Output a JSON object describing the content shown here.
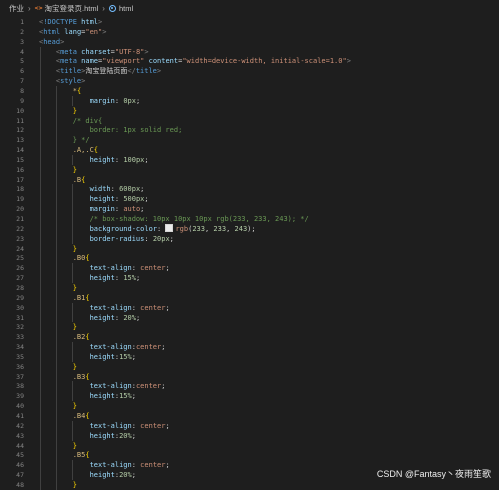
{
  "breadcrumb": {
    "folder": "作业",
    "file_icon": "html-file-icon",
    "file": "淘宝登录页.html",
    "element_icon": "symbol-element-icon",
    "element": "html"
  },
  "watermark": "CSDN @Fantasy丶夜雨笙歌",
  "code_lines": [
    {
      "n": "1",
      "t": [
        [
          "t-punct",
          "<"
        ],
        [
          "t-tag",
          "!DOCTYPE"
        ],
        [
          "t-text",
          " "
        ],
        [
          "t-attr",
          "html"
        ],
        [
          "t-punct",
          ">"
        ]
      ]
    },
    {
      "n": "2",
      "t": [
        [
          "t-punct",
          "<"
        ],
        [
          "t-tag",
          "html"
        ],
        [
          "t-text",
          " "
        ],
        [
          "t-attr",
          "lang"
        ],
        [
          "t-text",
          "="
        ],
        [
          "t-str",
          "\"en\""
        ],
        [
          "t-punct",
          ">"
        ]
      ]
    },
    {
      "n": "3",
      "t": [
        [
          "t-punct",
          "<"
        ],
        [
          "t-tag",
          "head"
        ],
        [
          "t-punct",
          ">"
        ]
      ]
    },
    {
      "n": "4",
      "t": [
        [
          "t-text",
          "    "
        ],
        [
          "t-punct",
          "<"
        ],
        [
          "t-tag",
          "meta"
        ],
        [
          "t-text",
          " "
        ],
        [
          "t-attr",
          "charset"
        ],
        [
          "t-text",
          "="
        ],
        [
          "t-str",
          "\"UTF-8\""
        ],
        [
          "t-punct",
          ">"
        ]
      ]
    },
    {
      "n": "5",
      "t": [
        [
          "t-text",
          "    "
        ],
        [
          "t-punct",
          "<"
        ],
        [
          "t-tag",
          "meta"
        ],
        [
          "t-text",
          " "
        ],
        [
          "t-attr",
          "name"
        ],
        [
          "t-text",
          "="
        ],
        [
          "t-str",
          "\"viewport\""
        ],
        [
          "t-text",
          " "
        ],
        [
          "t-attr",
          "content"
        ],
        [
          "t-text",
          "="
        ],
        [
          "t-str",
          "\"width=device-width, initial-scale=1.0\""
        ],
        [
          "t-punct",
          ">"
        ]
      ]
    },
    {
      "n": "6",
      "t": [
        [
          "t-text",
          "    "
        ],
        [
          "t-punct",
          "<"
        ],
        [
          "t-tag",
          "title"
        ],
        [
          "t-punct",
          ">"
        ],
        [
          "t-text",
          "淘宝登陆页面"
        ],
        [
          "t-punct",
          "</"
        ],
        [
          "t-tag",
          "title"
        ],
        [
          "t-punct",
          ">"
        ]
      ]
    },
    {
      "n": "7",
      "t": [
        [
          "t-text",
          "    "
        ],
        [
          "t-punct",
          "<"
        ],
        [
          "t-tag",
          "style"
        ],
        [
          "t-punct",
          ">"
        ]
      ]
    },
    {
      "n": "8",
      "t": [
        [
          "t-text",
          "        "
        ],
        [
          "t-sel",
          "*"
        ],
        [
          "t-brace",
          "{"
        ]
      ]
    },
    {
      "n": "9",
      "t": [
        [
          "t-text",
          "            "
        ],
        [
          "t-prop",
          "margin"
        ],
        [
          "t-text",
          ": "
        ],
        [
          "t-num",
          "0px"
        ],
        [
          "t-text",
          ";"
        ]
      ]
    },
    {
      "n": "10",
      "t": [
        [
          "t-text",
          "        "
        ],
        [
          "t-brace",
          "}"
        ]
      ]
    },
    {
      "n": "11",
      "t": [
        [
          "t-text",
          "        "
        ],
        [
          "t-com",
          "/* div{"
        ]
      ]
    },
    {
      "n": "12",
      "t": [
        [
          "t-text",
          "            "
        ],
        [
          "t-com",
          "border: 1px solid red;"
        ]
      ]
    },
    {
      "n": "13",
      "t": [
        [
          "t-text",
          "        "
        ],
        [
          "t-com",
          "} */"
        ]
      ]
    },
    {
      "n": "14",
      "t": [
        [
          "t-text",
          "        "
        ],
        [
          "t-sel",
          ".A,.C"
        ],
        [
          "t-brace",
          "{"
        ]
      ]
    },
    {
      "n": "15",
      "t": [
        [
          "t-text",
          "            "
        ],
        [
          "t-prop",
          "height"
        ],
        [
          "t-text",
          ": "
        ],
        [
          "t-num",
          "100px"
        ],
        [
          "t-text",
          ";"
        ]
      ]
    },
    {
      "n": "16",
      "t": [
        [
          "t-text",
          "        "
        ],
        [
          "t-brace",
          "}"
        ]
      ]
    },
    {
      "n": "17",
      "t": [
        [
          "t-text",
          "        "
        ],
        [
          "t-sel",
          ".B"
        ],
        [
          "t-brace",
          "{"
        ]
      ]
    },
    {
      "n": "18",
      "t": [
        [
          "t-text",
          "            "
        ],
        [
          "t-prop",
          "width"
        ],
        [
          "t-text",
          ": "
        ],
        [
          "t-num",
          "600px"
        ],
        [
          "t-text",
          ";"
        ]
      ]
    },
    {
      "n": "19",
      "t": [
        [
          "t-text",
          "            "
        ],
        [
          "t-prop",
          "height"
        ],
        [
          "t-text",
          ": "
        ],
        [
          "t-num",
          "500px"
        ],
        [
          "t-text",
          ";"
        ]
      ]
    },
    {
      "n": "20",
      "t": [
        [
          "t-text",
          "            "
        ],
        [
          "t-prop",
          "margin"
        ],
        [
          "t-text",
          ": "
        ],
        [
          "t-val",
          "auto"
        ],
        [
          "t-text",
          ";"
        ]
      ]
    },
    {
      "n": "21",
      "t": [
        [
          "t-text",
          "            "
        ],
        [
          "t-com",
          "/* box-shadow: 10px 10px 10px rgb(233, 233, 243); */"
        ]
      ]
    },
    {
      "n": "22",
      "t": [
        [
          "t-text",
          "            "
        ],
        [
          "t-prop",
          "background-color"
        ],
        [
          "t-text",
          ": "
        ],
        [
          "swatch",
          ""
        ],
        [
          "t-val",
          "rgb"
        ],
        [
          "t-text",
          "("
        ],
        [
          "t-num",
          "233"
        ],
        [
          "t-text",
          ", "
        ],
        [
          "t-num",
          "233"
        ],
        [
          "t-text",
          ", "
        ],
        [
          "t-num",
          "243"
        ],
        [
          "t-text",
          ");"
        ]
      ]
    },
    {
      "n": "23",
      "t": [
        [
          "t-text",
          "            "
        ],
        [
          "t-prop",
          "border-radius"
        ],
        [
          "t-text",
          ": "
        ],
        [
          "t-num",
          "20px"
        ],
        [
          "t-text",
          ";"
        ]
      ]
    },
    {
      "n": "24",
      "t": [
        [
          "t-text",
          "        "
        ],
        [
          "t-brace",
          "}"
        ]
      ]
    },
    {
      "n": "25",
      "t": [
        [
          "t-text",
          "        "
        ],
        [
          "t-sel",
          ".B0"
        ],
        [
          "t-brace",
          "{"
        ]
      ]
    },
    {
      "n": "26",
      "t": [
        [
          "t-text",
          "            "
        ],
        [
          "t-prop",
          "text-align"
        ],
        [
          "t-text",
          ": "
        ],
        [
          "t-val",
          "center"
        ],
        [
          "t-text",
          ";"
        ]
      ]
    },
    {
      "n": "27",
      "t": [
        [
          "t-text",
          "            "
        ],
        [
          "t-prop",
          "height"
        ],
        [
          "t-text",
          ": "
        ],
        [
          "t-num",
          "15%"
        ],
        [
          "t-text",
          ";"
        ]
      ]
    },
    {
      "n": "28",
      "t": [
        [
          "t-text",
          "        "
        ],
        [
          "t-brace",
          "}"
        ]
      ]
    },
    {
      "n": "29",
      "t": [
        [
          "t-text",
          "        "
        ],
        [
          "t-sel",
          ".B1"
        ],
        [
          "t-brace",
          "{"
        ]
      ]
    },
    {
      "n": "30",
      "t": [
        [
          "t-text",
          "            "
        ],
        [
          "t-prop",
          "text-align"
        ],
        [
          "t-text",
          ": "
        ],
        [
          "t-val",
          "center"
        ],
        [
          "t-text",
          ";"
        ]
      ]
    },
    {
      "n": "31",
      "t": [
        [
          "t-text",
          "            "
        ],
        [
          "t-prop",
          "height"
        ],
        [
          "t-text",
          ": "
        ],
        [
          "t-num",
          "20%"
        ],
        [
          "t-text",
          ";"
        ]
      ]
    },
    {
      "n": "32",
      "t": [
        [
          "t-text",
          "        "
        ],
        [
          "t-brace",
          "}"
        ]
      ]
    },
    {
      "n": "33",
      "t": [
        [
          "t-text",
          "        "
        ],
        [
          "t-sel",
          ".B2"
        ],
        [
          "t-brace",
          "{"
        ]
      ]
    },
    {
      "n": "34",
      "t": [
        [
          "t-text",
          "            "
        ],
        [
          "t-prop",
          "text-align"
        ],
        [
          "t-text",
          ":"
        ],
        [
          "t-val",
          "center"
        ],
        [
          "t-text",
          ";"
        ]
      ]
    },
    {
      "n": "35",
      "t": [
        [
          "t-text",
          "            "
        ],
        [
          "t-prop",
          "height"
        ],
        [
          "t-text",
          ":"
        ],
        [
          "t-num",
          "15%"
        ],
        [
          "t-text",
          ";"
        ]
      ]
    },
    {
      "n": "36",
      "t": [
        [
          "t-text",
          "        "
        ],
        [
          "t-brace",
          "}"
        ]
      ]
    },
    {
      "n": "37",
      "t": [
        [
          "t-text",
          "        "
        ],
        [
          "t-sel",
          ".B3"
        ],
        [
          "t-brace",
          "{"
        ]
      ]
    },
    {
      "n": "38",
      "t": [
        [
          "t-text",
          "            "
        ],
        [
          "t-prop",
          "text-align"
        ],
        [
          "t-text",
          ":"
        ],
        [
          "t-val",
          "center"
        ],
        [
          "t-text",
          ";"
        ]
      ]
    },
    {
      "n": "39",
      "t": [
        [
          "t-text",
          "            "
        ],
        [
          "t-prop",
          "height"
        ],
        [
          "t-text",
          ":"
        ],
        [
          "t-num",
          "15%"
        ],
        [
          "t-text",
          ";"
        ]
      ]
    },
    {
      "n": "40",
      "t": [
        [
          "t-text",
          "        "
        ],
        [
          "t-brace",
          "}"
        ]
      ]
    },
    {
      "n": "41",
      "t": [
        [
          "t-text",
          "        "
        ],
        [
          "t-sel",
          ".B4"
        ],
        [
          "t-brace",
          "{"
        ]
      ]
    },
    {
      "n": "42",
      "t": [
        [
          "t-text",
          "            "
        ],
        [
          "t-prop",
          "text-align"
        ],
        [
          "t-text",
          ": "
        ],
        [
          "t-val",
          "center"
        ],
        [
          "t-text",
          ";"
        ]
      ]
    },
    {
      "n": "43",
      "t": [
        [
          "t-text",
          "            "
        ],
        [
          "t-prop",
          "height"
        ],
        [
          "t-text",
          ":"
        ],
        [
          "t-num",
          "20%"
        ],
        [
          "t-text",
          ";"
        ]
      ]
    },
    {
      "n": "44",
      "t": [
        [
          "t-text",
          "        "
        ],
        [
          "t-brace",
          "}"
        ]
      ]
    },
    {
      "n": "45",
      "t": [
        [
          "t-text",
          "        "
        ],
        [
          "t-sel",
          ".B5"
        ],
        [
          "t-brace",
          "{"
        ]
      ]
    },
    {
      "n": "46",
      "t": [
        [
          "t-text",
          "            "
        ],
        [
          "t-prop",
          "text-align"
        ],
        [
          "t-text",
          ": "
        ],
        [
          "t-val",
          "center"
        ],
        [
          "t-text",
          ";"
        ]
      ]
    },
    {
      "n": "47",
      "t": [
        [
          "t-text",
          "            "
        ],
        [
          "t-prop",
          "height"
        ],
        [
          "t-text",
          ":"
        ],
        [
          "t-num",
          "20%"
        ],
        [
          "t-text",
          ";"
        ]
      ]
    },
    {
      "n": "48",
      "t": [
        [
          "t-text",
          "        "
        ],
        [
          "t-brace",
          "}"
        ]
      ]
    }
  ]
}
